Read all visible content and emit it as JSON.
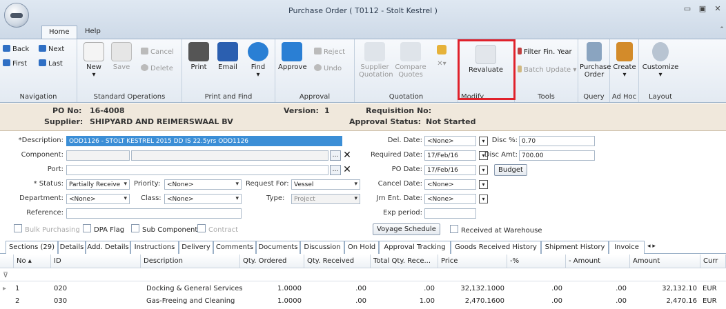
{
  "window": {
    "title": "Purchase Order ( T0112 - Stolt Kestrel )",
    "tabs": [
      "Home",
      "Help"
    ],
    "controls": [
      "minimize",
      "restore",
      "close"
    ]
  },
  "ribbon": {
    "navigation": {
      "label": "Navigation",
      "back": "Back",
      "next": "Next",
      "first": "First",
      "last": "Last"
    },
    "standard": {
      "label": "Standard Operations",
      "new": "New",
      "save": "Save",
      "cancel": "Cancel",
      "delete": "Delete"
    },
    "printfind": {
      "label": "Print and Find",
      "print": "Print",
      "email": "Email",
      "find": "Find"
    },
    "approval": {
      "label": "Approval",
      "approve": "Approve",
      "reject": "Reject",
      "undo": "Undo"
    },
    "quotation": {
      "label": "Quotation",
      "supplier": "Supplier\nQuotation",
      "compare": "Compare\nQuotes"
    },
    "modify": {
      "label": "Modify",
      "revaluate": "Revaluate"
    },
    "tools": {
      "label": "Tools",
      "filter": "Filter Fin. Year",
      "batch": "Batch Update"
    },
    "query": {
      "label": "Query",
      "po": "Purchase\nOrder"
    },
    "adhoc": {
      "label": "Ad Hoc",
      "create": "Create"
    },
    "layout": {
      "label": "Layout",
      "customize": "Customize"
    }
  },
  "header": {
    "po_label": "PO No:",
    "po_value": "16-4008",
    "version_label": "Version:",
    "version_value": "1",
    "req_label": "Requisition No:",
    "supplier_label": "Supplier:",
    "supplier_value": "SHIPYARD AND REIMERSWAAL BV",
    "approval_label": "Approval Status:",
    "approval_value": "Not Started"
  },
  "form": {
    "description_label": "*Description:",
    "description_value": "ODD1126 - STOLT KESTREL 2015 DD IS 22.5yrs ODD1126",
    "component_label": "Component:",
    "port_label": "Port:",
    "status_label": "* Status:",
    "status_value": "Partially Receive",
    "priority_label": "Priority:",
    "priority_value": "<None>",
    "request_label": "Request For:",
    "request_value": "Vessel",
    "department_label": "Department:",
    "department_value": "<None>",
    "class_label": "Class:",
    "class_value": "<None>",
    "type_label": "Type:",
    "type_value": "Project",
    "reference_label": "Reference:",
    "del_date_label": "Del. Date:",
    "del_date_value": "<None>",
    "req_date_label": "Required Date:",
    "req_date_value": "17/Feb/16",
    "po_date_label": "PO Date:",
    "po_date_value": "17/Feb/16",
    "cancel_date_label": "Cancel Date:",
    "cancel_date_value": "<None>",
    "jrn_label": "Jrn Ent. Date:",
    "jrn_value": "<None>",
    "exp_label": "Exp period:",
    "disc_pct_label": "Disc %:",
    "disc_pct_value": "0.70",
    "disc_amt_label": "Disc Amt:",
    "disc_amt_value": "700.00",
    "budget": "Budget",
    "voyage": "Voyage Schedule",
    "bulk": "Bulk Purchasing",
    "dpa": "DPA Flag",
    "sub": "Sub Component",
    "contract": "Contract",
    "received_wh": "Received at Warehouse"
  },
  "tabs": [
    "Sections (29)",
    "Details",
    "Add. Details",
    "Instructions",
    "Delivery",
    "Comments",
    "Documents",
    "Discussion",
    "On Hold",
    "Approval Tracking",
    "Goods Received History",
    "Shipment History",
    "Invoice"
  ],
  "grid": {
    "columns": [
      "No",
      "ID",
      "Description",
      "Qty. Ordered",
      "Qty. Received",
      "Total Qty. Rece...",
      "Price",
      "-%",
      "- Amount",
      "Amount",
      "Curr"
    ],
    "rows": [
      {
        "no": "1",
        "id": "020",
        "desc": "Docking & General Services",
        "ordered": "1.0000",
        "received": ".00",
        "total": ".00",
        "price": "32,132.1000",
        "pct": ".00",
        "minus": ".00",
        "amount": "32,132.10",
        "cur": "EUR"
      },
      {
        "no": "2",
        "id": "030",
        "desc": "Gas-Freeing and Cleaning",
        "ordered": "1.0000",
        "received": ".00",
        "total": "1.00",
        "price": "2,470.1600",
        "pct": ".00",
        "minus": ".00",
        "amount": "2,470.16",
        "cur": "EUR"
      }
    ]
  }
}
